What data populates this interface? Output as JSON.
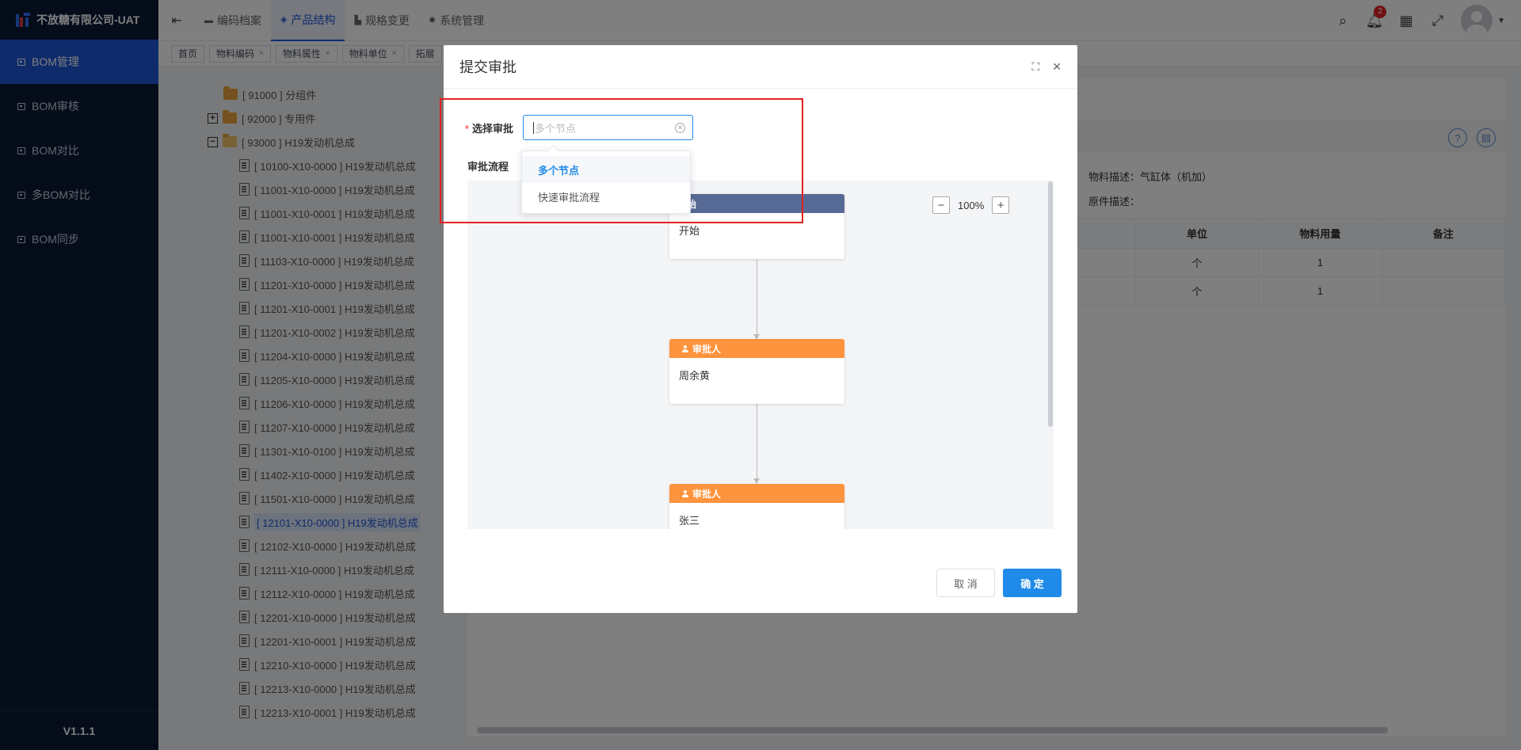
{
  "app": {
    "name": "不放糖有限公司-UAT",
    "version": "V1.1.1"
  },
  "sidebar": {
    "items": [
      {
        "label": "BOM管理",
        "active": true
      },
      {
        "label": "BOM审核",
        "active": false
      },
      {
        "label": "BOM对比",
        "active": false
      },
      {
        "label": "多BOM对比",
        "active": false
      },
      {
        "label": "BOM同步",
        "active": false
      }
    ]
  },
  "topnav": {
    "tabs": [
      {
        "label": "编码档案",
        "icon": "folder-icon"
      },
      {
        "label": "产品结构",
        "icon": "layers-icon",
        "active": true
      },
      {
        "label": "规格变更",
        "icon": "chart-icon"
      },
      {
        "label": "系统管理",
        "icon": "gear-icon"
      }
    ],
    "notification_count": "2"
  },
  "page_tabs": [
    {
      "label": "首页",
      "closable": false
    },
    {
      "label": "物料编码",
      "closable": true
    },
    {
      "label": "物料属性",
      "closable": true
    },
    {
      "label": "物料单位",
      "closable": true
    },
    {
      "label": "拓展",
      "closable": false
    }
  ],
  "tree": {
    "nodes": [
      {
        "label": "[ 91000 ] 分组件",
        "type": "folder",
        "indent": 1
      },
      {
        "label": "[ 92000 ] 专用件",
        "type": "folder",
        "indent": 0,
        "expander": "+"
      },
      {
        "label": "[ 93000 ] H19发动机总成",
        "type": "folder-open",
        "indent": 0,
        "expander": "−"
      },
      {
        "label": "[ 10100-X10-0000 ] H19发动机总成",
        "type": "doc",
        "indent": 2
      },
      {
        "label": "[ 11001-X10-0000 ] H19发动机总成",
        "type": "doc",
        "indent": 2
      },
      {
        "label": "[ 11001-X10-0001 ] H19发动机总成",
        "type": "doc",
        "indent": 2
      },
      {
        "label": "[ 11001-X10-0001 ] H19发动机总成",
        "type": "doc",
        "indent": 2
      },
      {
        "label": "[ 11103-X10-0000 ] H19发动机总成",
        "type": "doc",
        "indent": 2
      },
      {
        "label": "[ 11201-X10-0000 ] H19发动机总成",
        "type": "doc",
        "indent": 2
      },
      {
        "label": "[ 11201-X10-0001 ] H19发动机总成",
        "type": "doc",
        "indent": 2
      },
      {
        "label": "[ 11201-X10-0002 ] H19发动机总成",
        "type": "doc",
        "indent": 2
      },
      {
        "label": "[ 11204-X10-0000 ] H19发动机总成",
        "type": "doc",
        "indent": 2
      },
      {
        "label": "[ 11205-X10-0000 ] H19发动机总成",
        "type": "doc",
        "indent": 2
      },
      {
        "label": "[ 11206-X10-0000 ] H19发动机总成",
        "type": "doc",
        "indent": 2
      },
      {
        "label": "[ 11207-X10-0000 ] H19发动机总成",
        "type": "doc",
        "indent": 2
      },
      {
        "label": "[ 11301-X10-0100 ] H19发动机总成",
        "type": "doc",
        "indent": 2
      },
      {
        "label": "[ 11402-X10-0000 ] H19发动机总成",
        "type": "doc",
        "indent": 2
      },
      {
        "label": "[ 11501-X10-0000 ] H19发动机总成",
        "type": "doc",
        "indent": 2
      },
      {
        "label": "[ 12101-X10-0000 ] H19发动机总成",
        "type": "doc",
        "indent": 2,
        "selected": true
      },
      {
        "label": "[ 12102-X10-0000 ] H19发动机总成",
        "type": "doc",
        "indent": 2
      },
      {
        "label": "[ 12111-X10-0000 ] H19发动机总成",
        "type": "doc",
        "indent": 2
      },
      {
        "label": "[ 12112-X10-0000 ] H19发动机总成",
        "type": "doc",
        "indent": 2
      },
      {
        "label": "[ 12201-X10-0000 ] H19发动机总成",
        "type": "doc",
        "indent": 2
      },
      {
        "label": "[ 12201-X10-0001 ] H19发动机总成",
        "type": "doc",
        "indent": 2
      },
      {
        "label": "[ 12210-X10-0000 ] H19发动机总成",
        "type": "doc",
        "indent": 2
      },
      {
        "label": "[ 12213-X10-0000 ] H19发动机总成",
        "type": "doc",
        "indent": 2
      },
      {
        "label": "[ 12213-X10-0001 ] H19发动机总成",
        "type": "doc",
        "indent": 2
      }
    ]
  },
  "detail": {
    "material_desc": "物料描述：气缸体（机加）",
    "original_desc": "原件描述：",
    "table": {
      "headers": [
        "单位",
        "物料用量",
        "备注"
      ],
      "rows": [
        [
          "个",
          "1",
          ""
        ],
        [
          "个",
          "1",
          ""
        ]
      ]
    }
  },
  "dialog": {
    "title": "提交审批",
    "select_label": "选择审批",
    "select_placeholder": "多个节点",
    "options": [
      {
        "label": "多个节点",
        "selected": true
      },
      {
        "label": "快速审批流程",
        "selected": false
      }
    ],
    "flow_label": "审批流程",
    "zoom": "100%",
    "nodes": [
      {
        "head": "开始",
        "body": "开始",
        "kind": "start"
      },
      {
        "head": "审批人",
        "body": "周余黄",
        "kind": "approver"
      },
      {
        "head": "审批人",
        "body": "张三",
        "kind": "approver"
      }
    ],
    "cancel": "取 消",
    "ok": "确 定"
  },
  "colors": {
    "sidebar_bg": "#0b1a36",
    "accent": "#1f56d6",
    "primary": "#1f8ae8",
    "approver": "#ff943e",
    "start": "#576a95",
    "highlight": "#e62020"
  }
}
